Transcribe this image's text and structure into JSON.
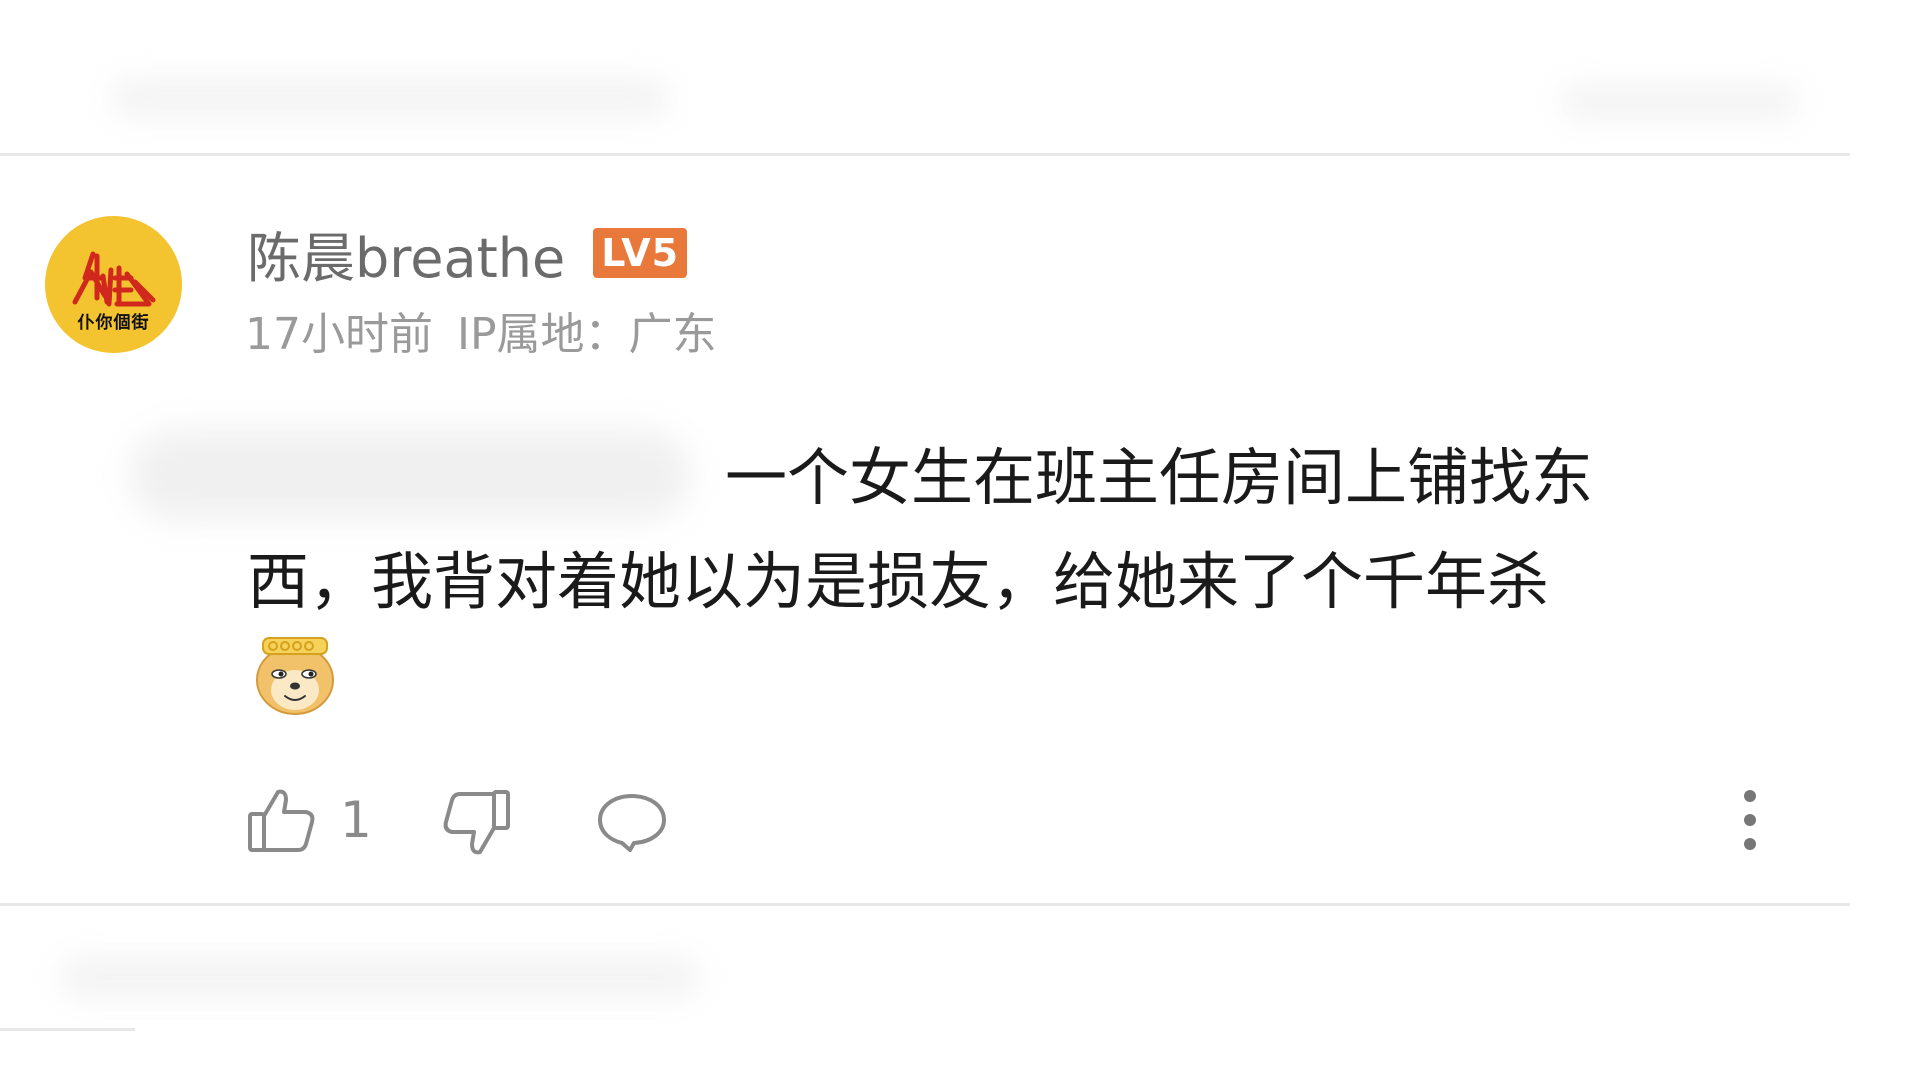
{
  "comment": {
    "username": "陈晨breathe",
    "level_badge": "LV5",
    "avatar_caption": "仆你個街",
    "time_ago": "17小时前",
    "ip_location": "IP属地：广东",
    "text_line_1": "一个女生在班主任房间上铺找东",
    "text_line_2": "西，我背对着她以为是损友，给她来了个千年杀",
    "emoji_name": "doge-monkey-king-emoji",
    "like_count": "1"
  },
  "icons": {
    "like": "thumbs-up-icon",
    "dislike": "thumbs-down-icon",
    "reply": "comment-bubble-icon",
    "more": "more-vertical-icon"
  },
  "colors": {
    "username": "#6b6b6b",
    "meta": "#9a9a9a",
    "badge": "#e8793b",
    "avatar_bg": "#f4c430",
    "avatar_logo": "#d0281c",
    "divider": "#e8e8e8",
    "icon": "#8a8a8a"
  }
}
